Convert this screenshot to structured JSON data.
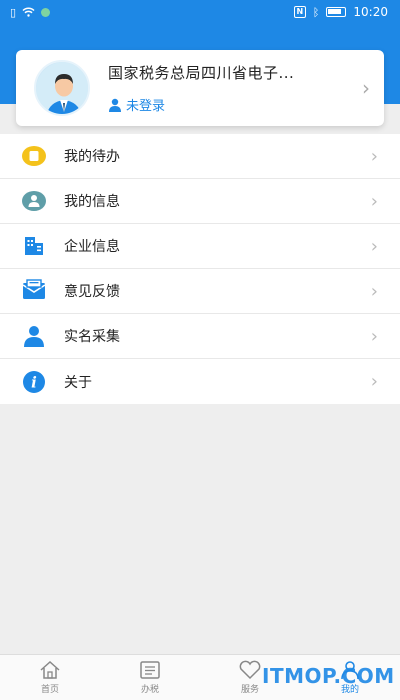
{
  "status_bar": {
    "time": "10:20"
  },
  "profile": {
    "org_name": "国家税务总局四川省电子...",
    "login_status": "未登录"
  },
  "menu": {
    "items": [
      {
        "label": "我的待办",
        "icon": "todo-icon"
      },
      {
        "label": "我的信息",
        "icon": "user-info-icon"
      },
      {
        "label": "企业信息",
        "icon": "company-icon"
      },
      {
        "label": "意见反馈",
        "icon": "feedback-icon"
      },
      {
        "label": "实名采集",
        "icon": "realname-icon"
      },
      {
        "label": "关于",
        "icon": "about-icon"
      }
    ]
  },
  "bottom_nav": {
    "items": [
      {
        "label": "首页",
        "icon": "home-icon",
        "active": false
      },
      {
        "label": "办税",
        "icon": "tax-icon",
        "active": false
      },
      {
        "label": "服务",
        "icon": "service-icon",
        "active": false
      },
      {
        "label": "我的",
        "icon": "mine-icon",
        "active": true
      }
    ]
  },
  "watermark": "ITMOP.COM",
  "colors": {
    "primary": "#1e88e5",
    "background": "#eeeeee",
    "todo_yellow": "#f4c21b",
    "user_teal": "#5f9ea8"
  }
}
